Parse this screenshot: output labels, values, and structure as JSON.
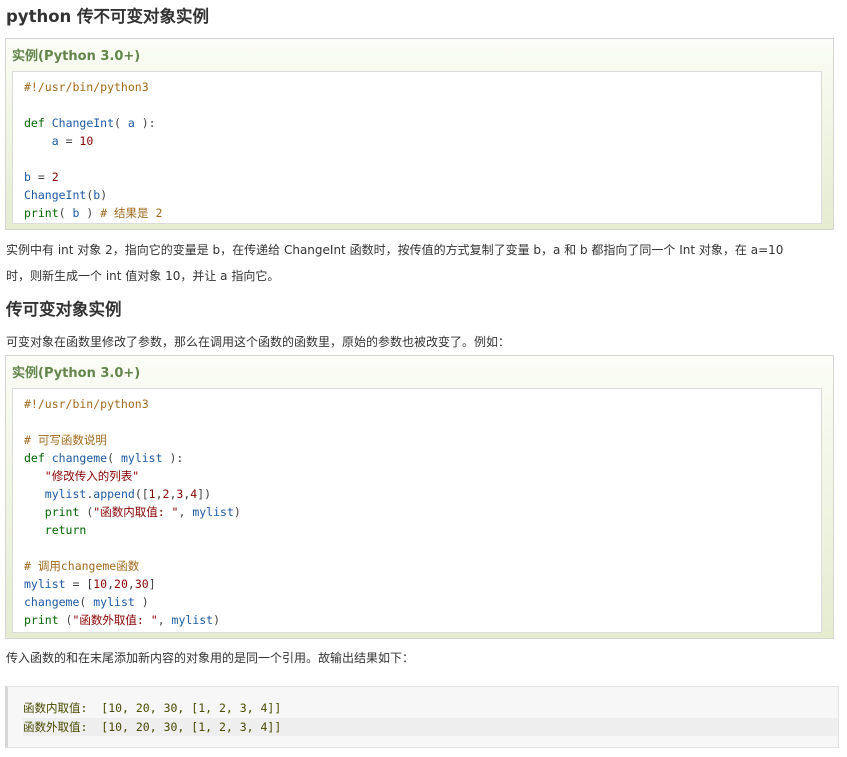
{
  "heading1": "python 传不可变对象实例",
  "example1": {
    "title": "实例(Python 3.0+)",
    "lines": [
      "#!/usr/bin/python3",
      "",
      "def ChangeInt( a ):",
      "    a = 10",
      "",
      "b = 2",
      "ChangeInt(b)",
      "print( b ) # 结果是 2"
    ]
  },
  "para1_line1": "实例中有 int 对象 2，指向它的变量是 b，在传递给 ChangeInt 函数时，按传值的方式复制了变量 b，a 和 b 都指向了同一个 Int 对象，在 a=10",
  "para1_line2": "时，则新生成一个 int 值对象 10，并让 a 指向它。",
  "heading2": "传可变对象实例",
  "para2": "可变对象在函数里修改了参数，那么在调用这个函数的函数里，原始的参数也被改变了。例如：",
  "example2": {
    "title": "实例(Python 3.0+)",
    "lines": [
      "#!/usr/bin/python3",
      "",
      "# 可写函数说明",
      "def changeme( mylist ):",
      "   \"修改传入的列表\"",
      "   mylist.append([1,2,3,4])",
      "   print (\"函数内取值: \", mylist)",
      "   return",
      "",
      "# 调用changeme函数",
      "mylist = [10,20,30]",
      "changeme( mylist )",
      "print (\"函数外取值: \", mylist)"
    ]
  },
  "para3": "传入函数的和在末尾添加新内容的对象用的是同一个引用。故输出结果如下：",
  "output": {
    "lines": [
      "函数内取值:  [10, 20, 30, [1, 2, 3, 4]]",
      "函数外取值:  [10, 20, 30, [1, 2, 3, 4]]"
    ]
  }
}
